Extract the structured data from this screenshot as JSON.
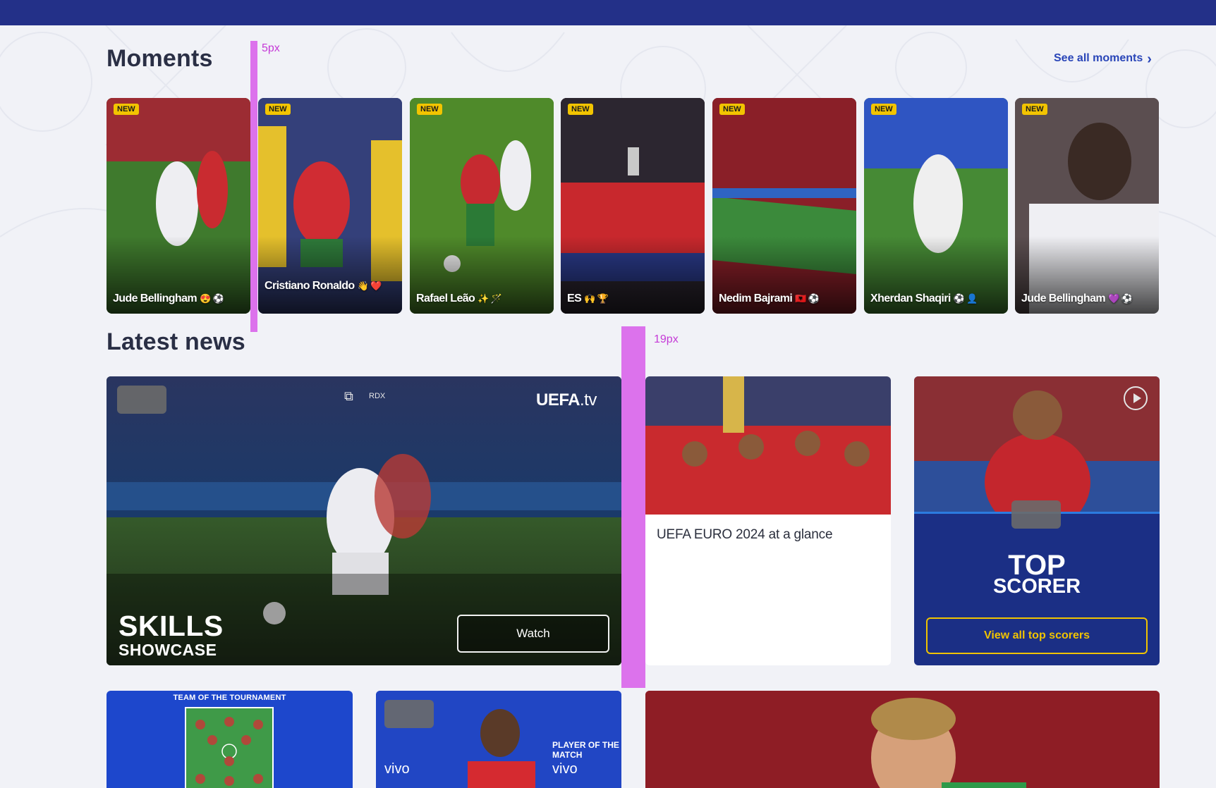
{
  "moments": {
    "title": "Moments",
    "see_all": "See all moments",
    "badge": "NEW",
    "items": [
      {
        "caption": "Jude Bellingham",
        "emoji": "😍 ⚽"
      },
      {
        "caption": "Cristiano Ronaldo",
        "emoji": "👋 ❤️"
      },
      {
        "caption": "Rafael Leão",
        "emoji": "✨ 🪄"
      },
      {
        "caption": "ES",
        "emoji": "🙌 🏆"
      },
      {
        "caption": "Nedim Bajrami",
        "emoji": "🇦🇱 ⚽"
      },
      {
        "caption": "Xherdan Shaqiri",
        "emoji": "⚽ 👤"
      },
      {
        "caption": "Jude Bellingham",
        "emoji": "💜 ⚽"
      }
    ]
  },
  "latest_news": {
    "title": "Latest news",
    "video": {
      "brand_main": "UEFA",
      "brand_suffix": ".tv",
      "rdx": "RDX",
      "headline_big": "SKILLS",
      "headline_small": "SHOWCASE",
      "watch_label": "Watch"
    },
    "glance": {
      "title": "UEFA EURO 2024 at a glance"
    },
    "top_scorer": {
      "line1": "TOP",
      "line2": "SCORER",
      "button": "View all top scorers"
    },
    "team_of_tournament": {
      "label": "TEAM OF THE TOURNAMENT"
    },
    "player_of_match": {
      "label": "PLAYER OF THE MATCH",
      "sponsor": "vivo"
    }
  },
  "guides": {
    "gap1": "5px",
    "gap2": "19px"
  },
  "colors": {
    "topbar": "#233088",
    "accent": "#f2c400",
    "link": "#2945b8",
    "guide": "#dc72ec"
  }
}
